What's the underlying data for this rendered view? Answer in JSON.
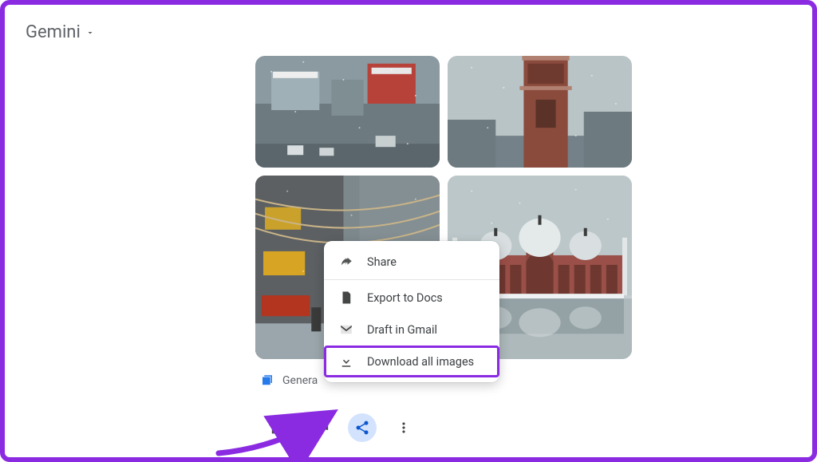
{
  "header": {
    "app_name": "Gemini"
  },
  "caption": {
    "text": "Genera"
  },
  "menu": {
    "share": "Share",
    "export_docs": "Export to Docs",
    "draft_gmail": "Draft in Gmail",
    "download_all": "Download all images"
  },
  "colors": {
    "annotation": "#8a2be2",
    "menu_highlight_bg": "#d3e3fd",
    "menu_highlight_fg": "#0b57d0"
  }
}
